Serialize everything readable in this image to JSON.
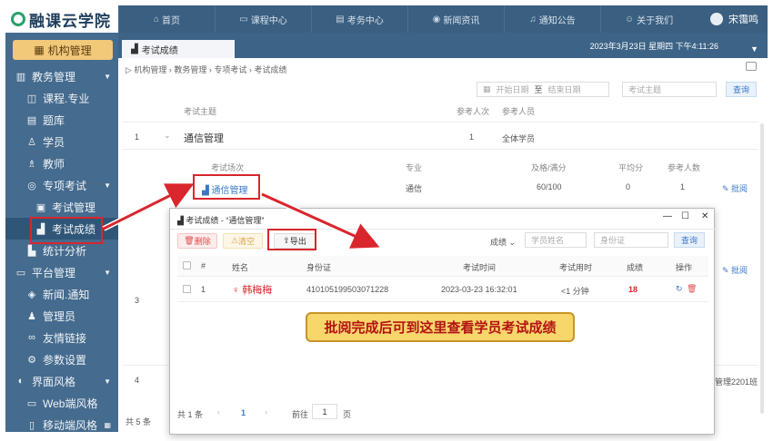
{
  "app": {
    "logo_text": "融课云学院",
    "user_name": "宋霭鸣"
  },
  "topnav": [
    {
      "label": "首页",
      "icon": "home-icon"
    },
    {
      "label": "课程中心",
      "icon": "monitor-icon"
    },
    {
      "label": "考务中心",
      "icon": "exam-icon"
    },
    {
      "label": "新闻资讯",
      "icon": "eye-icon"
    },
    {
      "label": "通知公告",
      "icon": "bell-icon"
    },
    {
      "label": "关于我们",
      "icon": "people-icon"
    }
  ],
  "sidebar": {
    "org_button": "机构管理",
    "items": [
      {
        "label": "教务管理",
        "icon": "chart-icon",
        "level": 1,
        "caret": true
      },
      {
        "label": "课程.专业",
        "icon": "book-icon",
        "level": 2
      },
      {
        "label": "题库",
        "icon": "list-icon",
        "level": 2
      },
      {
        "label": "学员",
        "icon": "user-icon",
        "level": 2
      },
      {
        "label": "教师",
        "icon": "teacher-icon",
        "level": 2
      },
      {
        "label": "专项考试",
        "icon": "target-icon",
        "level": 2,
        "caret": true
      },
      {
        "label": "考试管理",
        "icon": "doc-icon",
        "level": 3
      },
      {
        "label": "考试成绩",
        "icon": "score-icon",
        "level": 3,
        "active": true
      },
      {
        "label": "统计分析",
        "icon": "bar-icon",
        "level": 2
      },
      {
        "label": "平台管理",
        "icon": "platform-icon",
        "level": 1,
        "caret": true
      },
      {
        "label": "新闻.通知",
        "icon": "news-icon",
        "level": 2
      },
      {
        "label": "管理员",
        "icon": "admin-icon",
        "level": 2
      },
      {
        "label": "友情链接",
        "icon": "link-icon",
        "level": 2
      },
      {
        "label": "参数设置",
        "icon": "gear-icon",
        "level": 2
      },
      {
        "label": "界面风格",
        "icon": "style-icon",
        "level": 1,
        "caret": true
      },
      {
        "label": "Web端风格",
        "icon": "desktop-icon",
        "level": 2
      },
      {
        "label": "移动端风格",
        "icon": "mobile-icon",
        "level": 2
      }
    ]
  },
  "tabbar": {
    "active_tab": "考试成绩",
    "datetime": "2023年3月23日 星期四 下午4:11:26"
  },
  "breadcrumb": "机构管理 › 教务管理 › 专项考试 › 考试成绩",
  "filters": {
    "start_date": "开始日期",
    "end_date": "结束日期",
    "sep": "至",
    "subject_placeholder": "考试主题",
    "query": "查询"
  },
  "main_table": {
    "headers": {
      "subject": "考试主题",
      "participants": "参考人次",
      "target": "参考人员"
    },
    "row1": {
      "index": "1",
      "subject": "通信管理",
      "participants": "1",
      "target": "全体学员"
    },
    "sub_headers": {
      "session": "考试场次",
      "major": "专业",
      "pass_full": "及格/满分",
      "avg": "平均分",
      "count": "参考人数"
    },
    "sub_row": {
      "session": "通信管理",
      "major": "通信",
      "pass_full": "60/100",
      "avg": "0",
      "count": "1",
      "action": "批阅"
    },
    "row3_index": "3",
    "row4_index": "4",
    "row4_target": "管理2201班",
    "action2": "批阅",
    "footer": "共 5 条"
  },
  "modal": {
    "title": "考试成绩 - “通信管理”",
    "buttons": {
      "delete": "删除",
      "clear": "清空",
      "export": "导出"
    },
    "score_filter": "成绩",
    "name_placeholder": "学员姓名",
    "id_placeholder": "身份证",
    "query": "查询",
    "headers": {
      "idx": "#",
      "name": "姓名",
      "idcard": "身份证",
      "time": "考试时间",
      "duration": "考试用时",
      "score": "成绩",
      "op": "操作"
    },
    "rows": [
      {
        "idx": "1",
        "name": "韩梅梅",
        "idcard": "410105199503071228",
        "time": "2023-03-23 16:32:01",
        "duration": "<1 分钟",
        "score": "18"
      }
    ],
    "footer": {
      "total": "共 1 条",
      "page": "1",
      "goto": "前往",
      "goto_value": "1",
      "page_unit": "页"
    }
  },
  "banner": "批阅完成后可到这里查看学员考试成绩"
}
